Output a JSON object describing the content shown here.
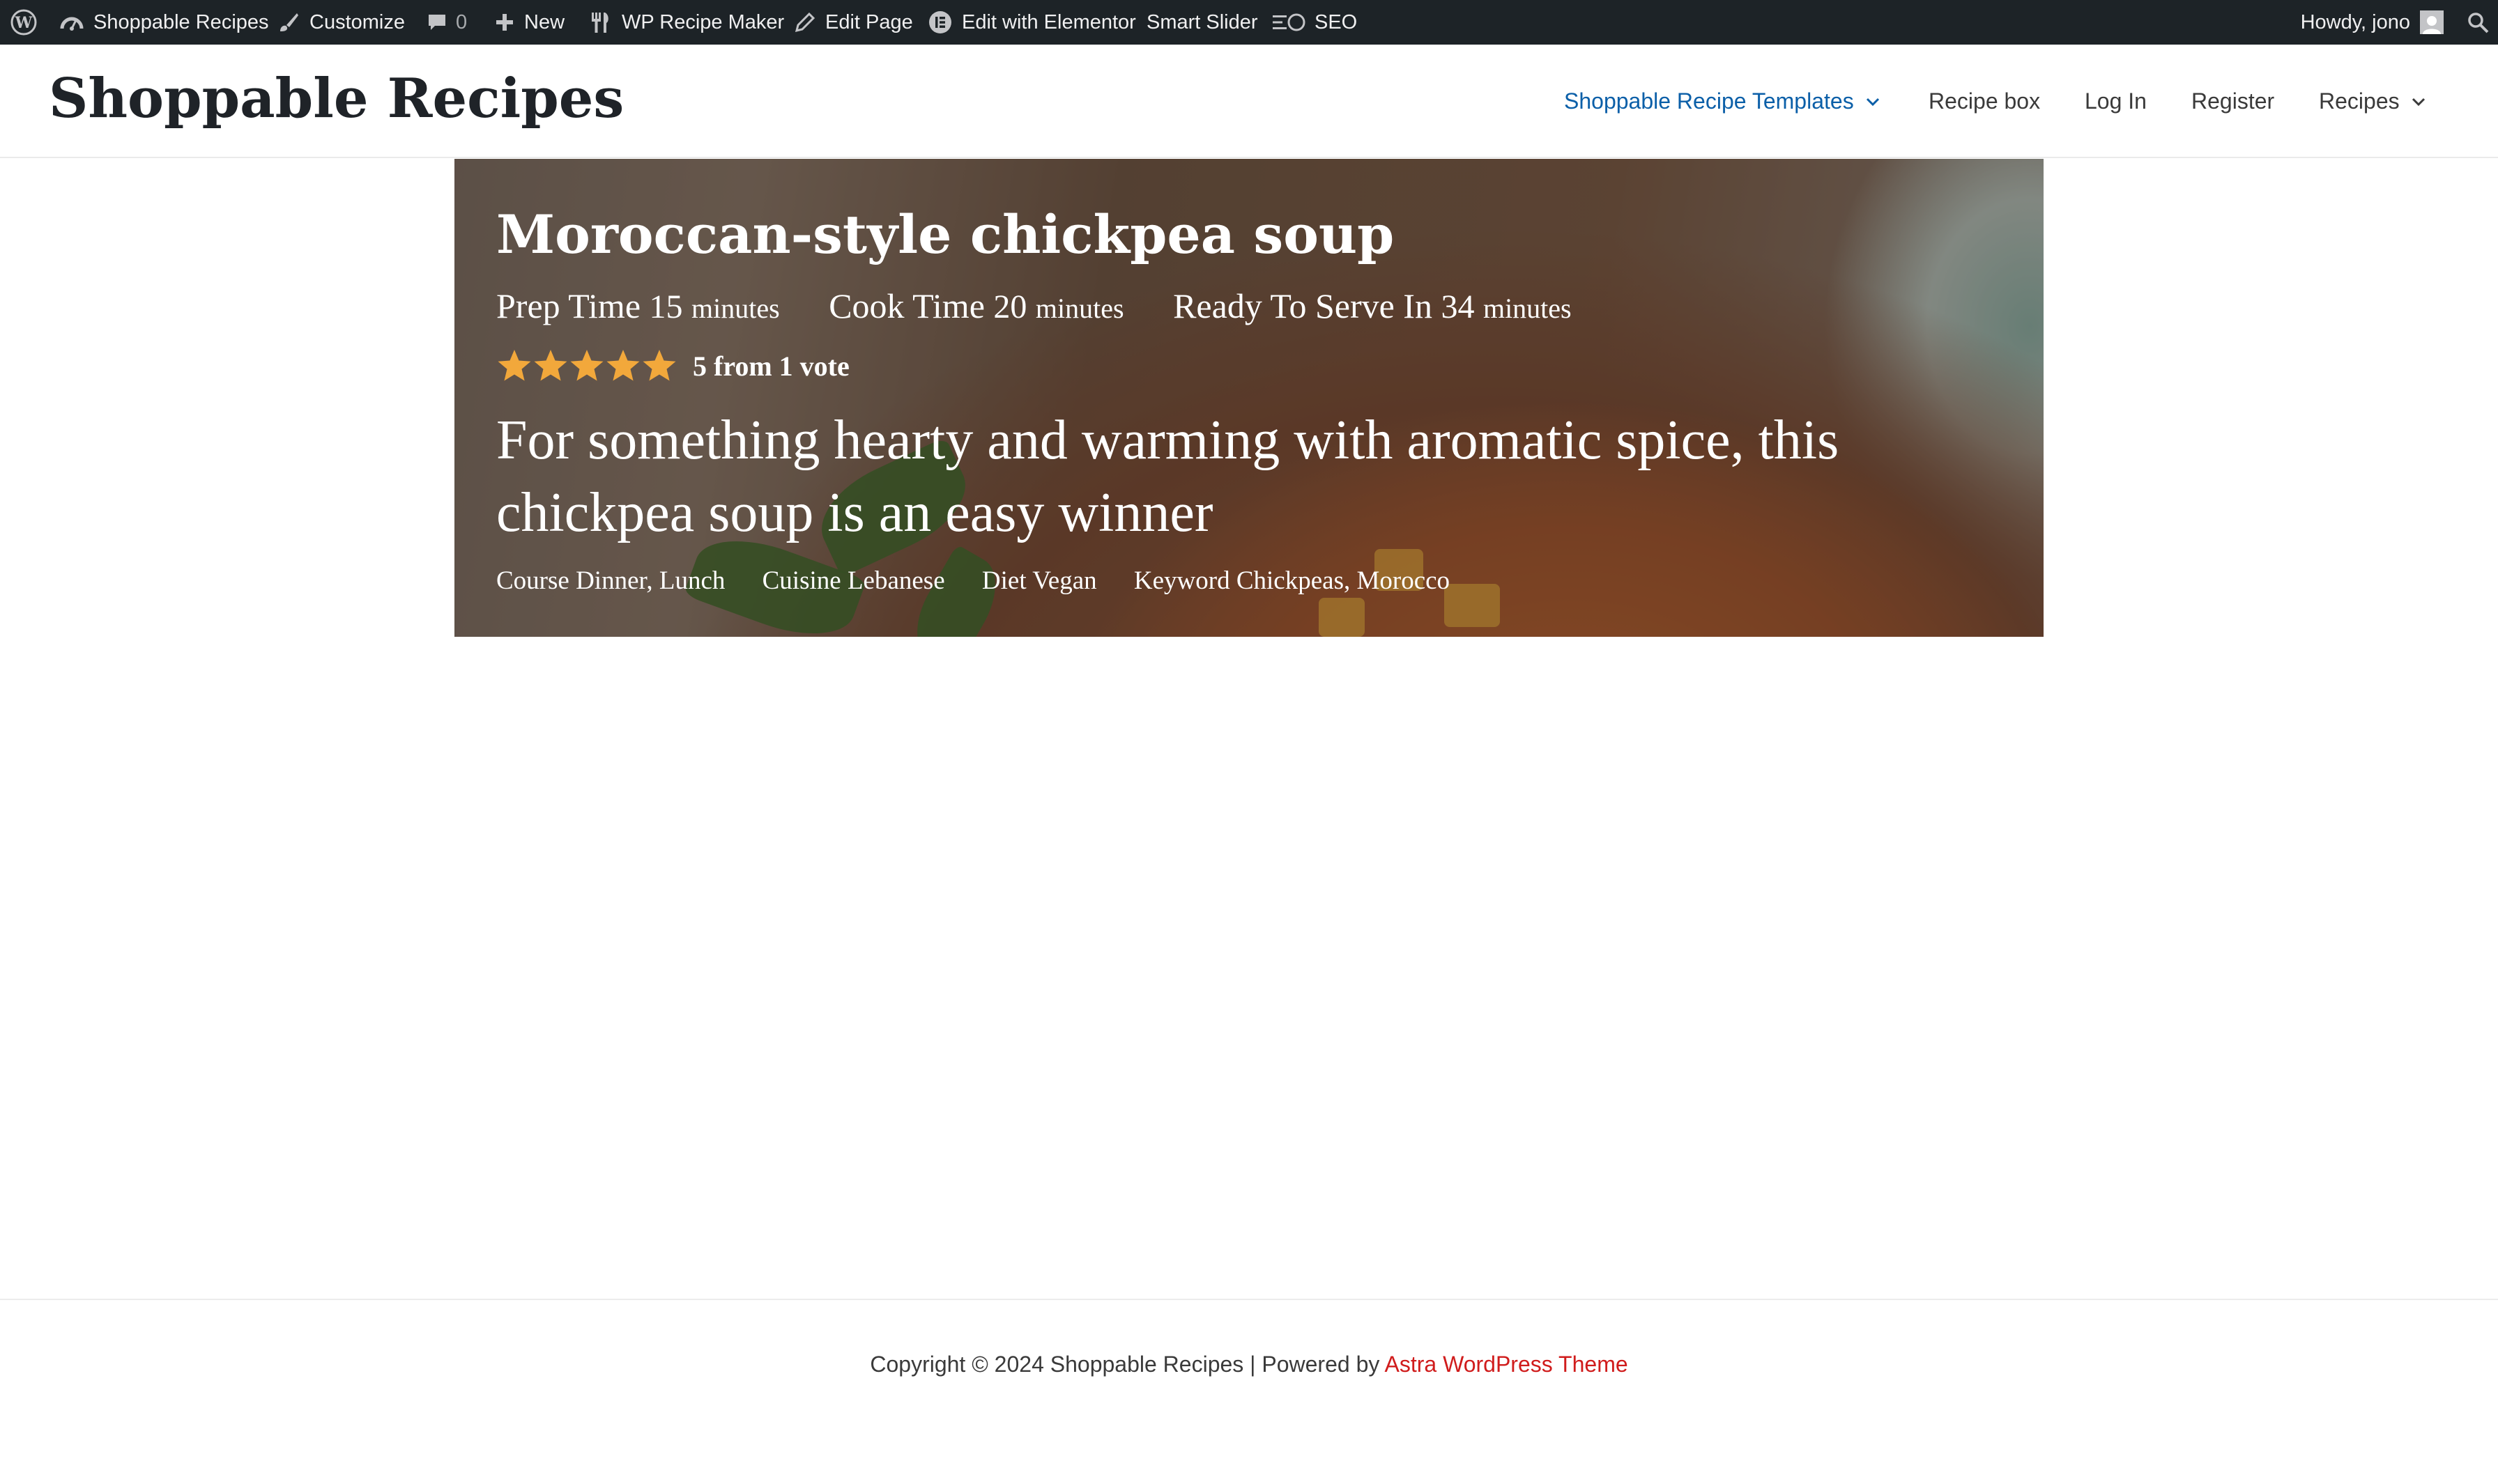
{
  "admin_bar": {
    "site_name": "Shoppable Recipes",
    "customize": "Customize",
    "comments_count": "0",
    "new": "New",
    "wp_recipe_maker": "WP Recipe Maker",
    "edit_page": "Edit Page",
    "edit_with_elementor": "Edit with Elementor",
    "smart_slider": "Smart Slider",
    "seo": "SEO",
    "howdy": "Howdy, jono"
  },
  "header": {
    "site_title": "Shoppable Recipes",
    "nav": [
      {
        "label": "Shoppable Recipe Templates",
        "has_dropdown": true,
        "active": true
      },
      {
        "label": "Recipe box"
      },
      {
        "label": "Log In"
      },
      {
        "label": "Register"
      },
      {
        "label": "Recipes",
        "has_dropdown": true
      }
    ]
  },
  "recipe": {
    "title": "Moroccan-style chickpea soup",
    "prep": {
      "label": "Prep Time",
      "value": "15",
      "unit": "minutes"
    },
    "cook": {
      "label": "Cook Time",
      "value": "20",
      "unit": "minutes"
    },
    "ready": {
      "label": "Ready To Serve In",
      "value": "34",
      "unit": "minutes"
    },
    "rating": {
      "stars": 5,
      "text": "5 from 1 vote"
    },
    "summary": "For something hearty and warming with aromatic spice, this chickpea soup is an easy winner",
    "tags": {
      "course": {
        "label": "Course",
        "value": "Dinner, Lunch"
      },
      "cuisine": {
        "label": "Cuisine",
        "value": "Lebanese"
      },
      "diet": {
        "label": "Diet",
        "value": "Vegan"
      },
      "keyword": {
        "label": "Keyword",
        "value": "Chickpeas, Morocco"
      }
    }
  },
  "footer": {
    "copyright": "Copyright © 2024 Shoppable Recipes | Powered by",
    "theme_link": "Astra WordPress Theme"
  },
  "colors": {
    "admin_bar_bg": "#1d2327",
    "nav_active": "#0b5fa8",
    "star": "#f2a83b",
    "footer_link": "#d01c1c"
  }
}
